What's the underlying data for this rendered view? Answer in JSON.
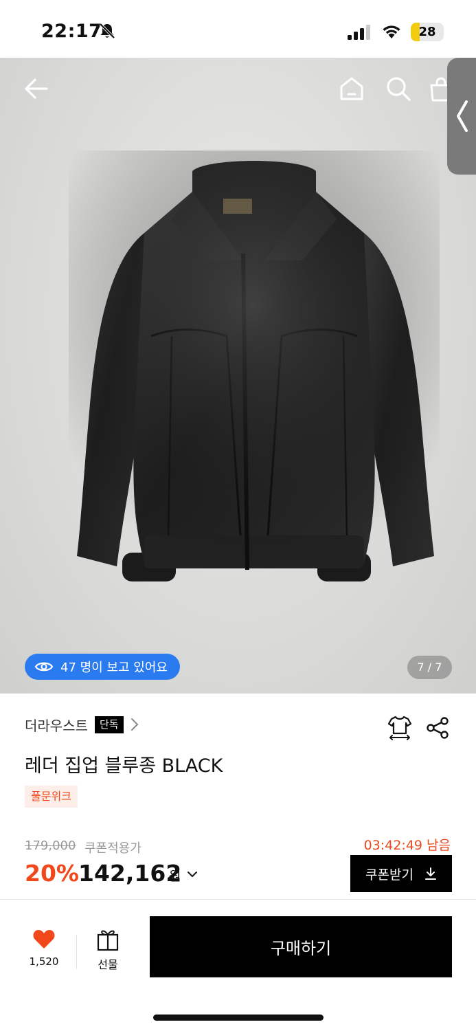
{
  "status_bar": {
    "time": "22:17",
    "battery_level": "28",
    "battery_percent_fill": 28,
    "icons": [
      "bell-off-icon",
      "signal-icon",
      "wifi-icon",
      "battery-icon"
    ]
  },
  "hero": {
    "viewers_text": "47 명이 보고 있어요",
    "page_indicator": "7 / 7",
    "icons": [
      "back-arrow-icon",
      "home-icon",
      "search-icon",
      "cart-icon",
      "chevron-left-icon"
    ]
  },
  "product": {
    "brand": "더라우스트",
    "exclusive_badge": "단독",
    "title": "레더 집업 블루종 BLACK",
    "tag": "풀문위크",
    "original_price": "179,000",
    "coupon_price_label": "쿠폰적용가",
    "countdown": "03:42:49 남음",
    "discount": "20%",
    "price": "142,162",
    "currency": "원",
    "coupon_button": "쿠폰받기"
  },
  "bottom_bar": {
    "like_count": "1,520",
    "gift_label": "선물",
    "buy_label": "구매하기"
  },
  "colors": {
    "accent_orange": "#f0471b",
    "viewers_blue": "#2b7bf0",
    "tag_bg": "#fdeee9"
  }
}
